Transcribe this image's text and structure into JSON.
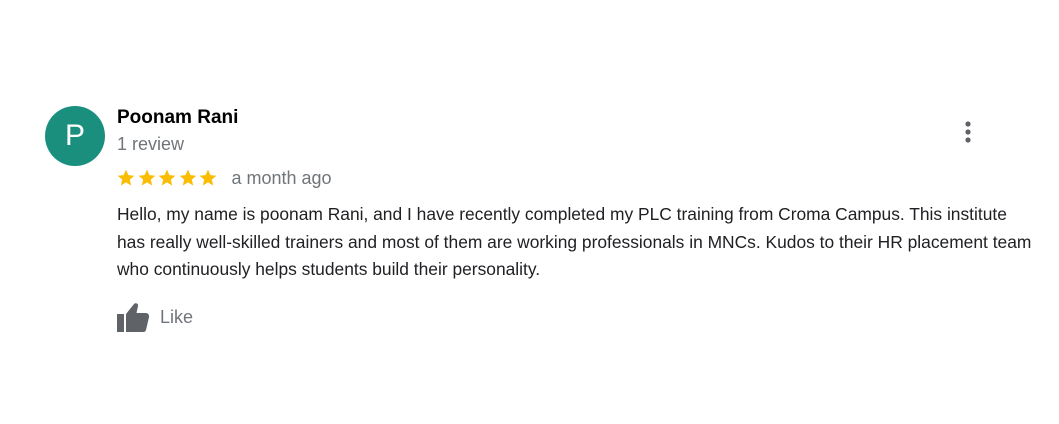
{
  "reviewer": {
    "avatar_letter": "P",
    "avatar_color": "#1a8f7e",
    "name": "Poonam Rani",
    "review_count": "1 review"
  },
  "rating": {
    "stars": 5,
    "max_stars": 5,
    "star_color": "#fbbc04",
    "date": "a month ago"
  },
  "review": {
    "text": "Hello, my name is poonam Rani, and I have recently completed my PLC training from Croma Campus. This institute has really well-skilled trainers and most of them are working professionals in MNCs. Kudos to their HR placement team who continuously helps students build their personality."
  },
  "actions": {
    "like_label": "Like",
    "like_icon": "thumbs-up-icon",
    "more_icon": "more-vert-icon"
  }
}
